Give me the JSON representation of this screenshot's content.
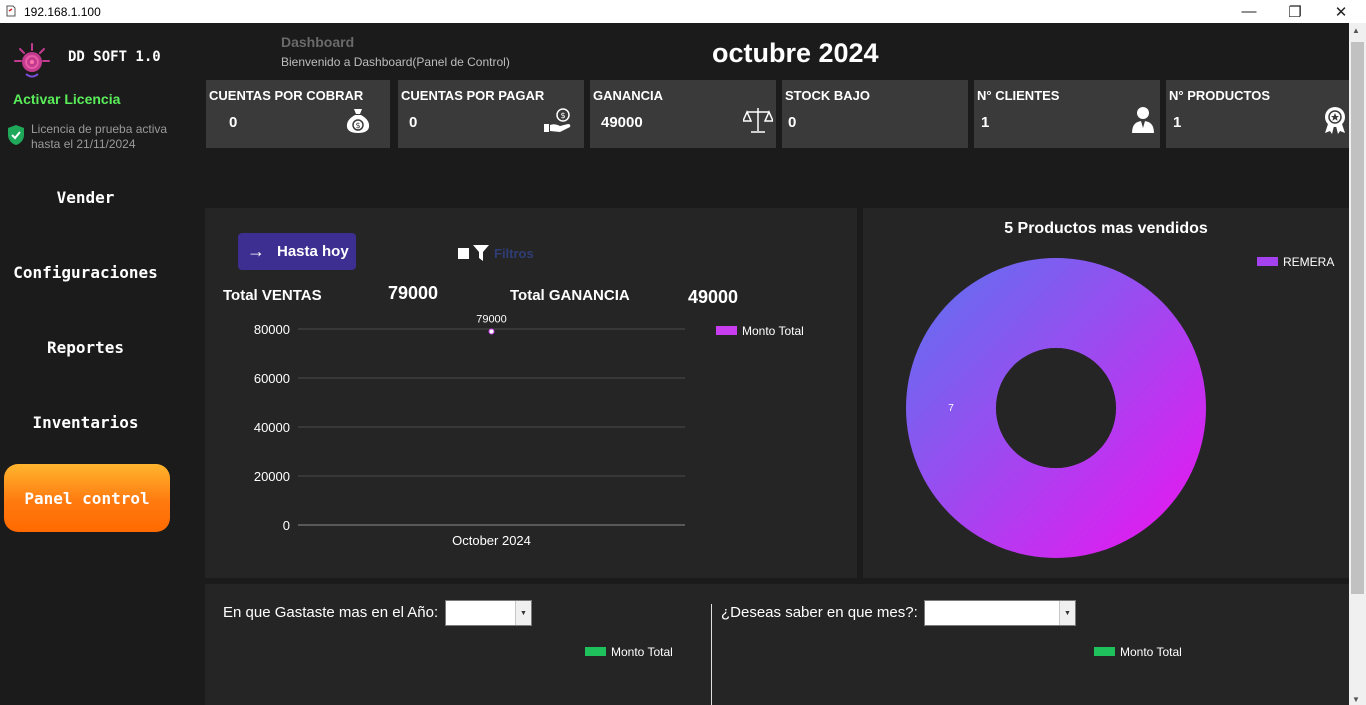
{
  "window": {
    "title": "192.168.1.100"
  },
  "sidebar": {
    "brand": "DD SOFT 1.0",
    "activate_label": "Activar Licencia",
    "license_line1": "Licencia de prueba activa",
    "license_line2": "hasta el 21/11/2024",
    "items": [
      {
        "label": "Vender"
      },
      {
        "label": "Configuraciones"
      },
      {
        "label": "Reportes"
      },
      {
        "label": "Inventarios"
      },
      {
        "label": "Panel control"
      }
    ]
  },
  "header": {
    "title": "Dashboard",
    "subtitle": "Bienvenido a Dashboard(Panel de Control)",
    "month": "octubre 2024"
  },
  "cards": [
    {
      "label": "CUENTAS POR COBRAR",
      "value": "0",
      "icon": "money-bag-icon"
    },
    {
      "label": "CUENTAS POR PAGAR",
      "value": "0",
      "icon": "hand-coin-icon"
    },
    {
      "label": "GANANCIA",
      "value": "49000",
      "icon": "balance-scale-icon"
    },
    {
      "label": "STOCK BAJO",
      "value": "0",
      "icon": ""
    },
    {
      "label": "N° CLIENTES",
      "value": "1",
      "icon": "user-icon"
    },
    {
      "label": "N° PRODUCTOS",
      "value": "1",
      "icon": "award-badge-icon"
    }
  ],
  "sales": {
    "button_label": "Hasta hoy",
    "filter_label": "Filtros",
    "total_sales_label": "Total VENTAS",
    "total_sales_value": "79000",
    "total_profit_label": "Total GANANCIA",
    "total_profit_value": "49000"
  },
  "pie": {
    "title": "5 Productos mas vendidos"
  },
  "bottom": {
    "year_label": "En que Gastaste mas en el Año:",
    "year_value": "",
    "month_label": "¿Deseas saber en que mes?:",
    "month_value": "",
    "legend_left": "Monto Total",
    "legend_right": "Monto Total",
    "legend_color": "#1ec15b"
  },
  "colors": {
    "accent_orange": "#ff8a1f",
    "button_purple": "#3d2e91",
    "series_magenta": "#c93df0",
    "license_green": "#5aef5a"
  },
  "chart_data": [
    {
      "type": "line",
      "categories": [
        "October 2024"
      ],
      "series": [
        {
          "name": "Monto Total",
          "values": [
            79000
          ]
        }
      ],
      "data_labels": [
        "79000"
      ],
      "yticks": [
        0,
        20000,
        40000,
        60000,
        80000
      ],
      "ylim": [
        0,
        80000
      ],
      "grid": true,
      "legend": "top-right",
      "color": "#c93df0"
    },
    {
      "type": "pie",
      "title": "5 Productos mas vendidos",
      "categories": [
        "REMERA"
      ],
      "values": [
        7
      ],
      "data_labels": [
        "7"
      ],
      "donut": true,
      "legend": "top-right"
    }
  ]
}
